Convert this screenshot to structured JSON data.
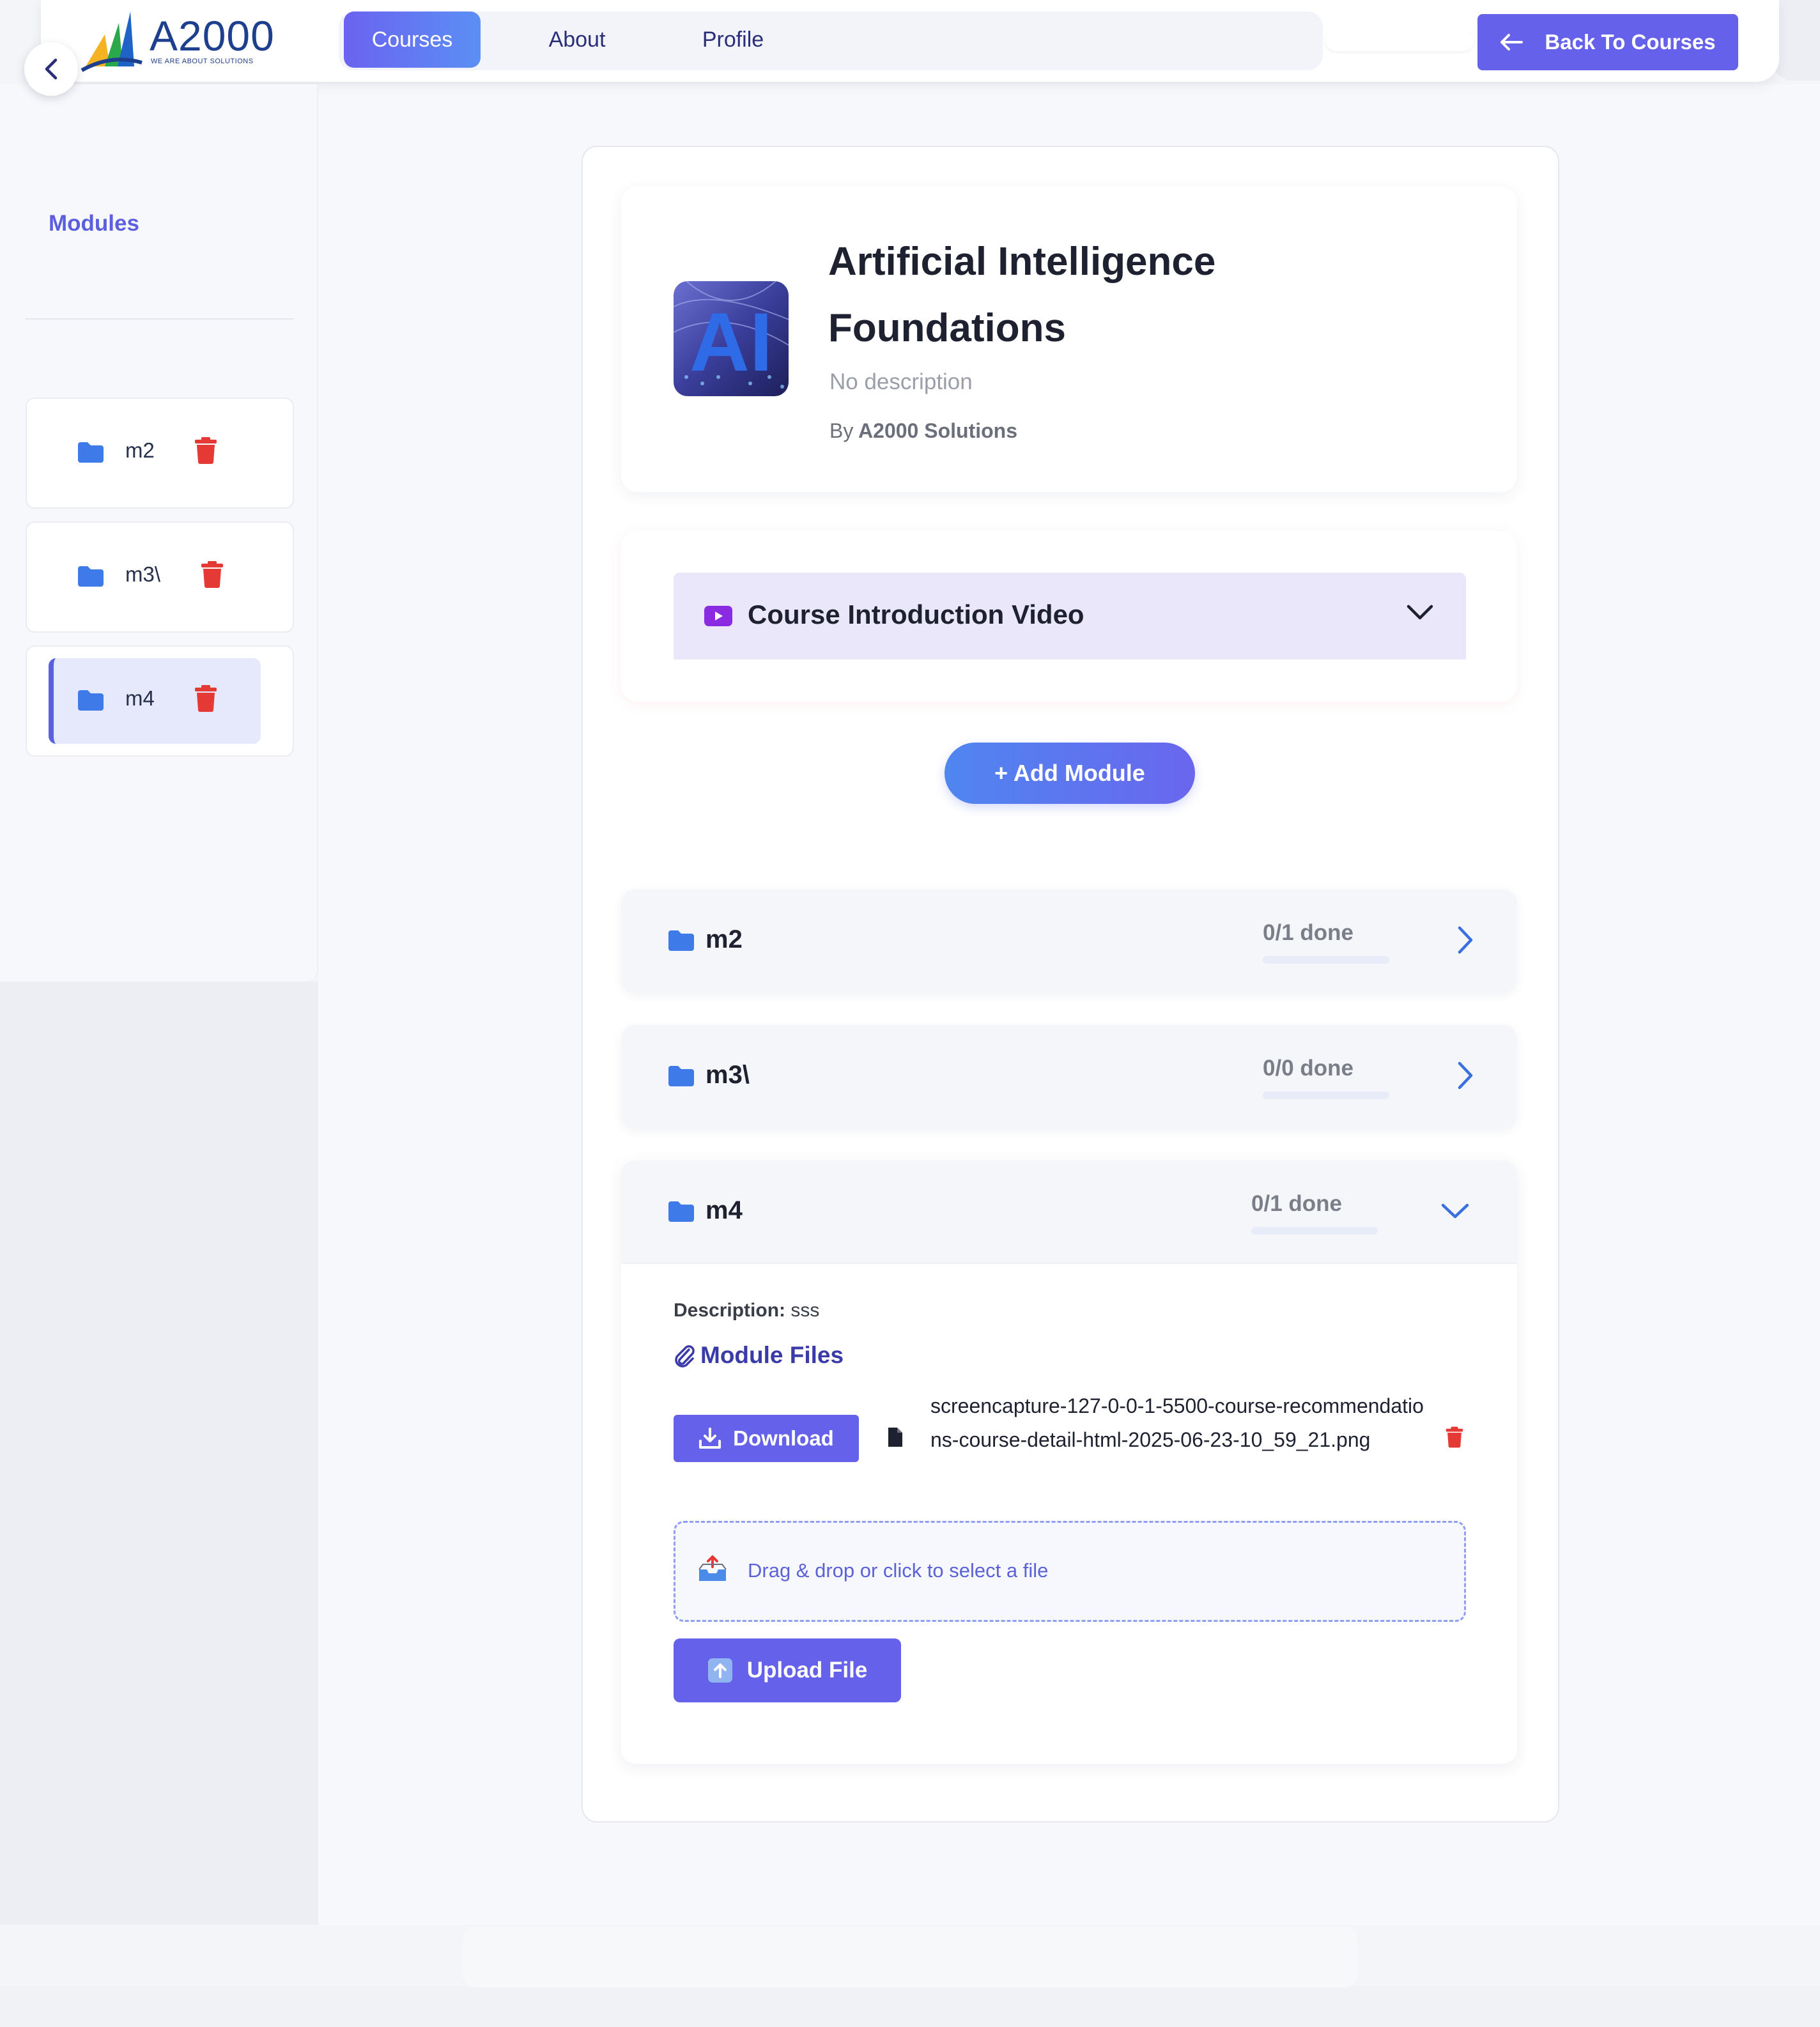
{
  "nav": {
    "logo_text": "A2000",
    "logo_tagline": "WE ARE ABOUT SOLUTIONS",
    "tabs": [
      {
        "label": "Courses",
        "active": true
      },
      {
        "label": "About",
        "active": false
      },
      {
        "label": "Profile",
        "active": false
      }
    ],
    "back_label": "Back To Courses"
  },
  "sidebar": {
    "title": "Modules",
    "items": [
      {
        "label": "m2",
        "active": false
      },
      {
        "label": "m3\\",
        "active": false
      },
      {
        "label": "m4",
        "active": true
      }
    ]
  },
  "course": {
    "title": "Artificial Intelligence Foundations",
    "description": "No description",
    "by_prefix": "By",
    "author": "A2000 Solutions",
    "thumbnail_text": "AI"
  },
  "video": {
    "label": "Course Introduction Video"
  },
  "add_module_label": "+ Add Module",
  "modules": [
    {
      "name": "m2",
      "progress_text": "0/1 done",
      "progress": 0,
      "expanded": false
    },
    {
      "name": "m3\\",
      "progress_text": "0/0 done",
      "progress": 0,
      "expanded": false
    },
    {
      "name": "m4",
      "progress_text": "0/1 done",
      "progress": 0,
      "expanded": true
    }
  ],
  "expanded_module": {
    "description_label": "Description:",
    "description_value": "sss",
    "files_title": "Module Files",
    "download_label": "Download",
    "file_name": "screencapture-127-0-0-1-5500-course-recommendations-course-detail-html-2025-06-23-10_59_21.png",
    "dropzone_text": "Drag & drop or click to select a file",
    "upload_label": "Upload File"
  },
  "colors": {
    "accent": "#6561ea",
    "accent_blue": "#4f86f0",
    "folder": "#3f7be8",
    "danger": "#e53935",
    "sidebar_title": "#5b5fdf"
  }
}
